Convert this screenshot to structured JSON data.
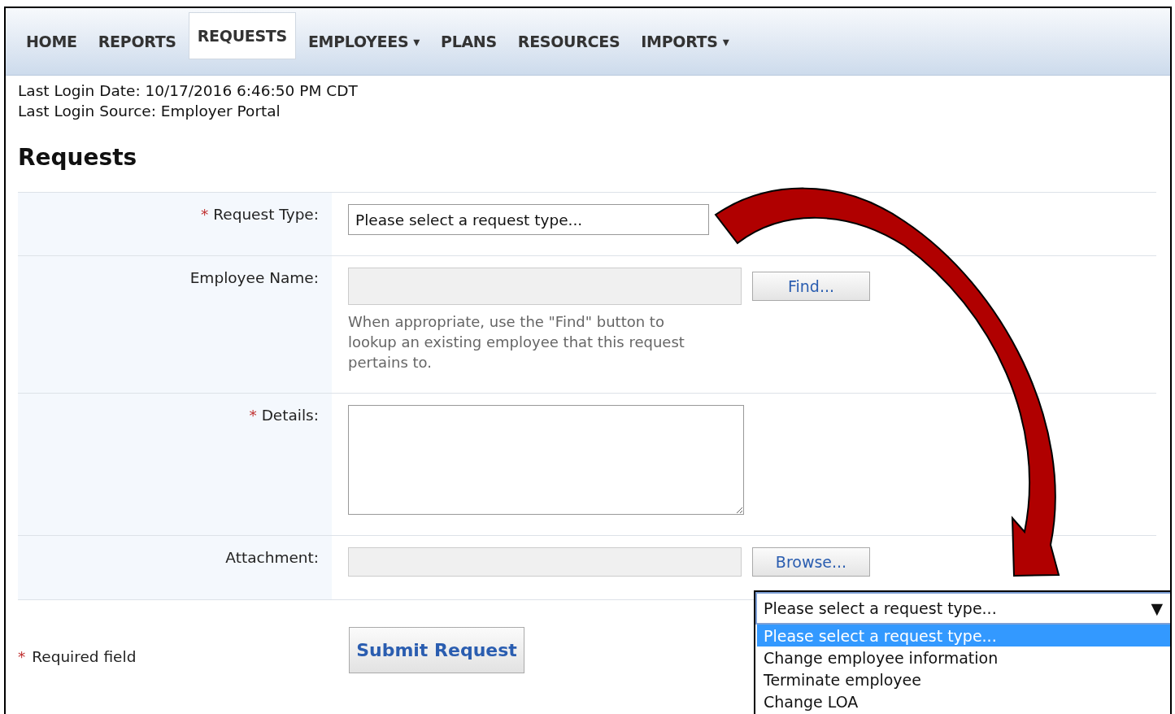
{
  "nav": {
    "items": [
      {
        "label": "HOME",
        "selected": false
      },
      {
        "label": "REPORTS",
        "selected": false
      },
      {
        "label": "REQUESTS",
        "selected": true
      },
      {
        "label": "EMPLOYEES",
        "selected": false,
        "caret": "▾"
      },
      {
        "label": "PLANS",
        "selected": false
      },
      {
        "label": "RESOURCES",
        "selected": false
      },
      {
        "label": "IMPORTS",
        "selected": false,
        "caret": "▾"
      }
    ]
  },
  "login": [
    "Last Login Date: 10/17/2016 6:46:50 PM CDT",
    "Last Login Source: Employer Portal"
  ],
  "heading": "Requests",
  "form": {
    "rows": [
      {
        "kind": "select",
        "marker": "*",
        "label": "Request Type:",
        "value": "Please select a request type..."
      },
      {
        "kind": "lookup",
        "label": "Employee Name:",
        "disabled": true,
        "button": "Find...",
        "help": "When appropriate, use the \"Find\" button to lookup an existing employee that this request pertains to."
      },
      {
        "kind": "textarea",
        "marker": "*",
        "label": "Details:"
      },
      {
        "kind": "file",
        "label": "Attachment:",
        "disabled": true,
        "button": "Browse..."
      }
    ],
    "required_note": {
      "marker": "*",
      "text": "Required field"
    },
    "submit": "Submit Request"
  },
  "dropdown": {
    "value": "Please select a request type...",
    "caret": "▼",
    "options": [
      {
        "label": "Please select a request type...",
        "selected": true
      },
      {
        "label": "Change employee information",
        "selected": false
      },
      {
        "label": "Terminate employee",
        "selected": false
      },
      {
        "label": "Change LOA",
        "selected": false
      }
    ]
  }
}
